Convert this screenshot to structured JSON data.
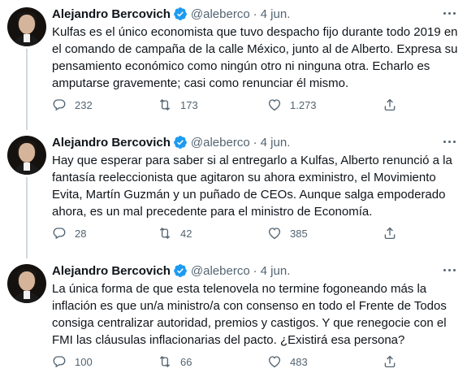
{
  "tweets": [
    {
      "name": "Alejandro Bercovich",
      "handle": "@aleberco",
      "separator": "·",
      "date": "4 jun.",
      "lines": [
        "Kulfas es el único economista que tuvo despacho fijo durante todo 2019 en",
        "el comando de campaña de la calle México, junto al de Alberto. Expresa su",
        "pensamiento económico como ningún otro ni ninguna otra. Echarlo es",
        "amputarse gravemente; casi como renunciar él mismo."
      ],
      "replies": "232",
      "retweets": "173",
      "likes": "1.273"
    },
    {
      "name": "Alejandro Bercovich",
      "handle": "@aleberco",
      "separator": "·",
      "date": "4 jun.",
      "lines": [
        "Hay que esperar para saber si al entregarlo a Kulfas, Alberto renunció a la",
        "fantasía reeleccionista que agitaron su ahora exministro, el Movimiento",
        "Evita, Martín Guzmán y un puñado de CEOs. Aunque salga empoderado",
        "ahora, es un mal precedente para el ministro de Economía."
      ],
      "replies": "28",
      "retweets": "42",
      "likes": "385"
    },
    {
      "name": "Alejandro Bercovich",
      "handle": "@aleberco",
      "separator": "·",
      "date": "4 jun.",
      "lines": [
        "La única forma de que esta telenovela no termine fogoneando más la",
        "inflación es que un/a ministro/a con consenso en todo el Frente de Todos",
        "consiga centralizar autoridad, premios y castigos. Y que renegocie con el",
        "FMI las cláusulas inflacionarias del pacto. ¿Existirá esa persona?"
      ],
      "replies": "100",
      "retweets": "66",
      "likes": "483"
    }
  ],
  "colors": {
    "verified": "#1d9bf0",
    "secondary_text": "#536471",
    "thread_line": "#cfd9de"
  },
  "icons": {
    "verified": "verified-badge-icon",
    "more": "more-options-icon",
    "reply": "reply-icon",
    "retweet": "retweet-icon",
    "like": "heart-icon",
    "share": "share-icon"
  }
}
